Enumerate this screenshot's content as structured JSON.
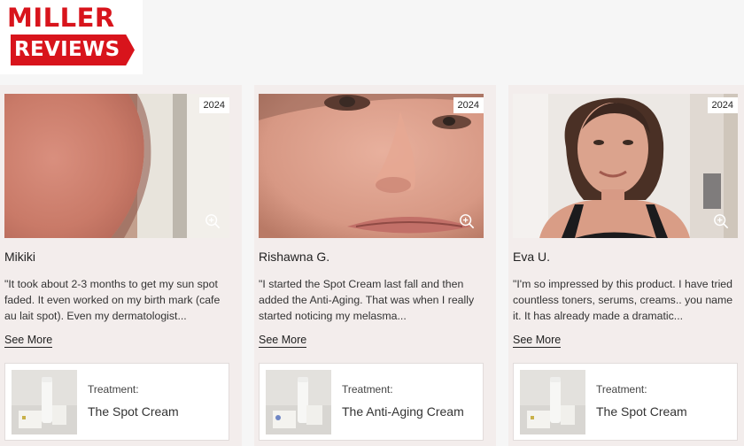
{
  "logo": {
    "line1": "MILLER",
    "line2": "REVIEWS",
    "brand_color": "#d8141c"
  },
  "reviews": [
    {
      "year": "2024",
      "name": "Mikiki",
      "quote": "\"It took about 2-3 months to get my sun spot faded. It even worked on my birth mark (cafe au lait spot). Even my dermatologist...",
      "see_more": "See More",
      "treatment_label": "Treatment:",
      "treatment_name": "The Spot Cream"
    },
    {
      "year": "2024",
      "name": "Rishawna G.",
      "quote": "\"I started the Spot Cream last fall and then added the Anti-Aging. That was when I really started noticing my melasma...",
      "see_more": "See More",
      "treatment_label": "Treatment:",
      "treatment_name": "The Anti-Aging Cream"
    },
    {
      "year": "2024",
      "name": "Eva U.",
      "quote": "\"I'm so impressed by this product. I have tried countless toners, serums, creams.. you name it. It has already made a dramatic...",
      "see_more": "See More",
      "treatment_label": "Treatment:",
      "treatment_name": "The Spot Cream"
    }
  ],
  "icons": {
    "zoom": "zoom-in-icon"
  }
}
